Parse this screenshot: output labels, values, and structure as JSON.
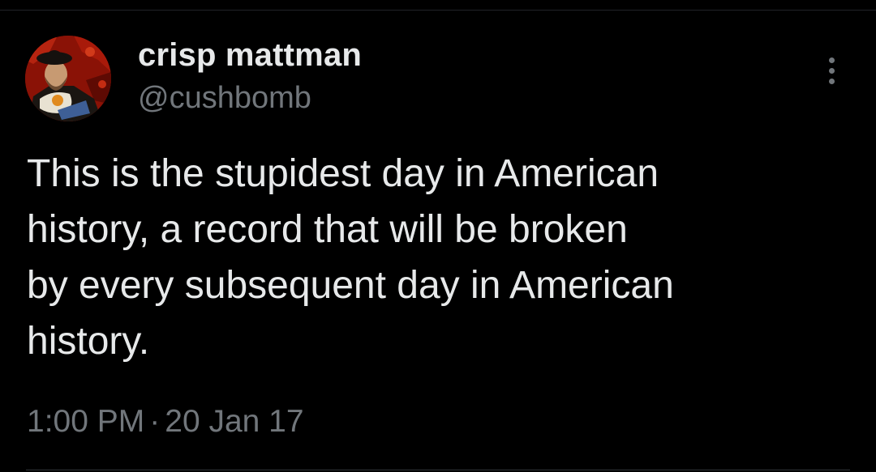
{
  "tweet": {
    "author": {
      "display_name": "crisp mattman",
      "handle": "@cushbomb",
      "avatar_icon": "portrait-avatar"
    },
    "text": "This is the stupidest day in American\nhistory, a record that will be broken\nby every subsequent day in American\nhistory.",
    "time": "1:00 PM",
    "separator": "·",
    "date": "20 Jan 17",
    "more_icon": "more-options-icon"
  },
  "colors": {
    "background": "#000000",
    "primary_text": "#e7e9ea",
    "secondary_text": "#71767b",
    "divider": "#2f3336"
  }
}
